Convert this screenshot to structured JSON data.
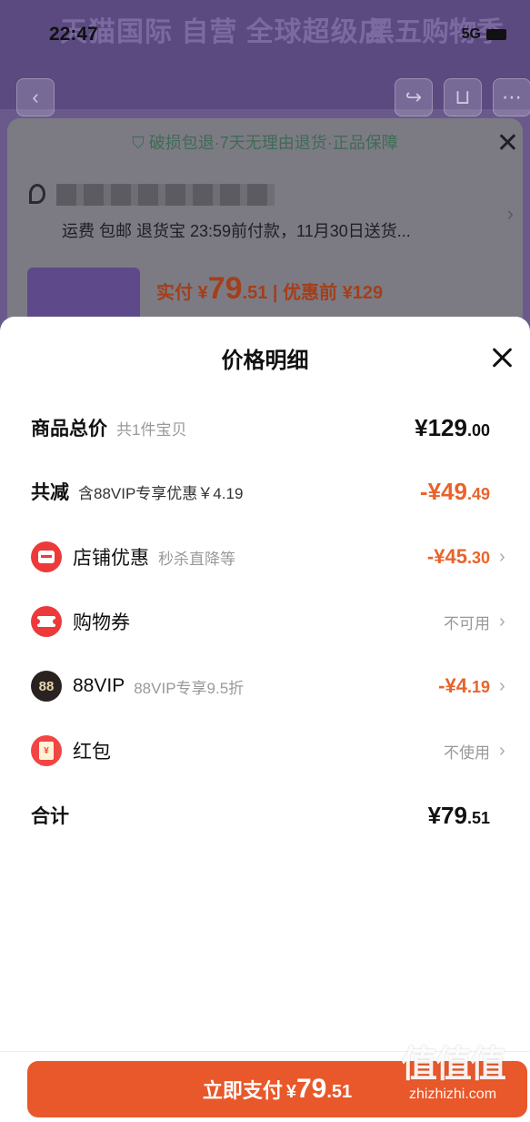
{
  "status_bar": {
    "time": "22:47",
    "network": "5G"
  },
  "background_page": {
    "banner_left": "天猫国际 自营 全球超级店",
    "banner_right": "黑五购物季",
    "guarantee": "破损包退·7天无理由退货·正品保障",
    "shipping": "运费 包邮 退货宝 23:59前付款，11月30日送货...",
    "pay_label": "实付 ¥",
    "pay_int": "79",
    "pay_dec": ".51",
    "before_discount": "| 优惠前 ¥129"
  },
  "modal": {
    "title": "价格明细",
    "rows": [
      {
        "label": "商品总价",
        "sub": "共1件宝贝",
        "val_int": "¥129",
        "val_dec": ".00"
      },
      {
        "label": "共减",
        "sub": "含88VIP专享优惠￥4.19",
        "val_int": "-¥49",
        "val_dec": ".49"
      },
      {
        "label": "店铺优惠",
        "sub": "秒杀直降等",
        "val_int": "-¥45",
        "val_dec": ".30",
        "icon": "shop-icon"
      },
      {
        "label": "购物券",
        "status": "不可用",
        "icon": "coupon-icon"
      },
      {
        "label": "88VIP",
        "sub": "88VIP专享9.5折",
        "val_int": "-¥4",
        "val_dec": ".19",
        "icon": "vip-88-icon",
        "icon_text": "88"
      },
      {
        "label": "红包",
        "status": "不使用",
        "icon": "red-packet-icon",
        "icon_text": "¥"
      },
      {
        "label": "合计",
        "val_int": "¥79",
        "val_dec": ".51"
      }
    ],
    "pay_button": {
      "label": "立即支付",
      "amount_prefix": "¥",
      "amount_int": "79",
      "amount_dec": ".51"
    }
  },
  "watermark": {
    "logo": "值值值",
    "url": "zhizhizhi.com"
  },
  "colors": {
    "accent": "#e8642c",
    "pay_button": "#e8582a",
    "red_icon": "#ec3a3a"
  }
}
